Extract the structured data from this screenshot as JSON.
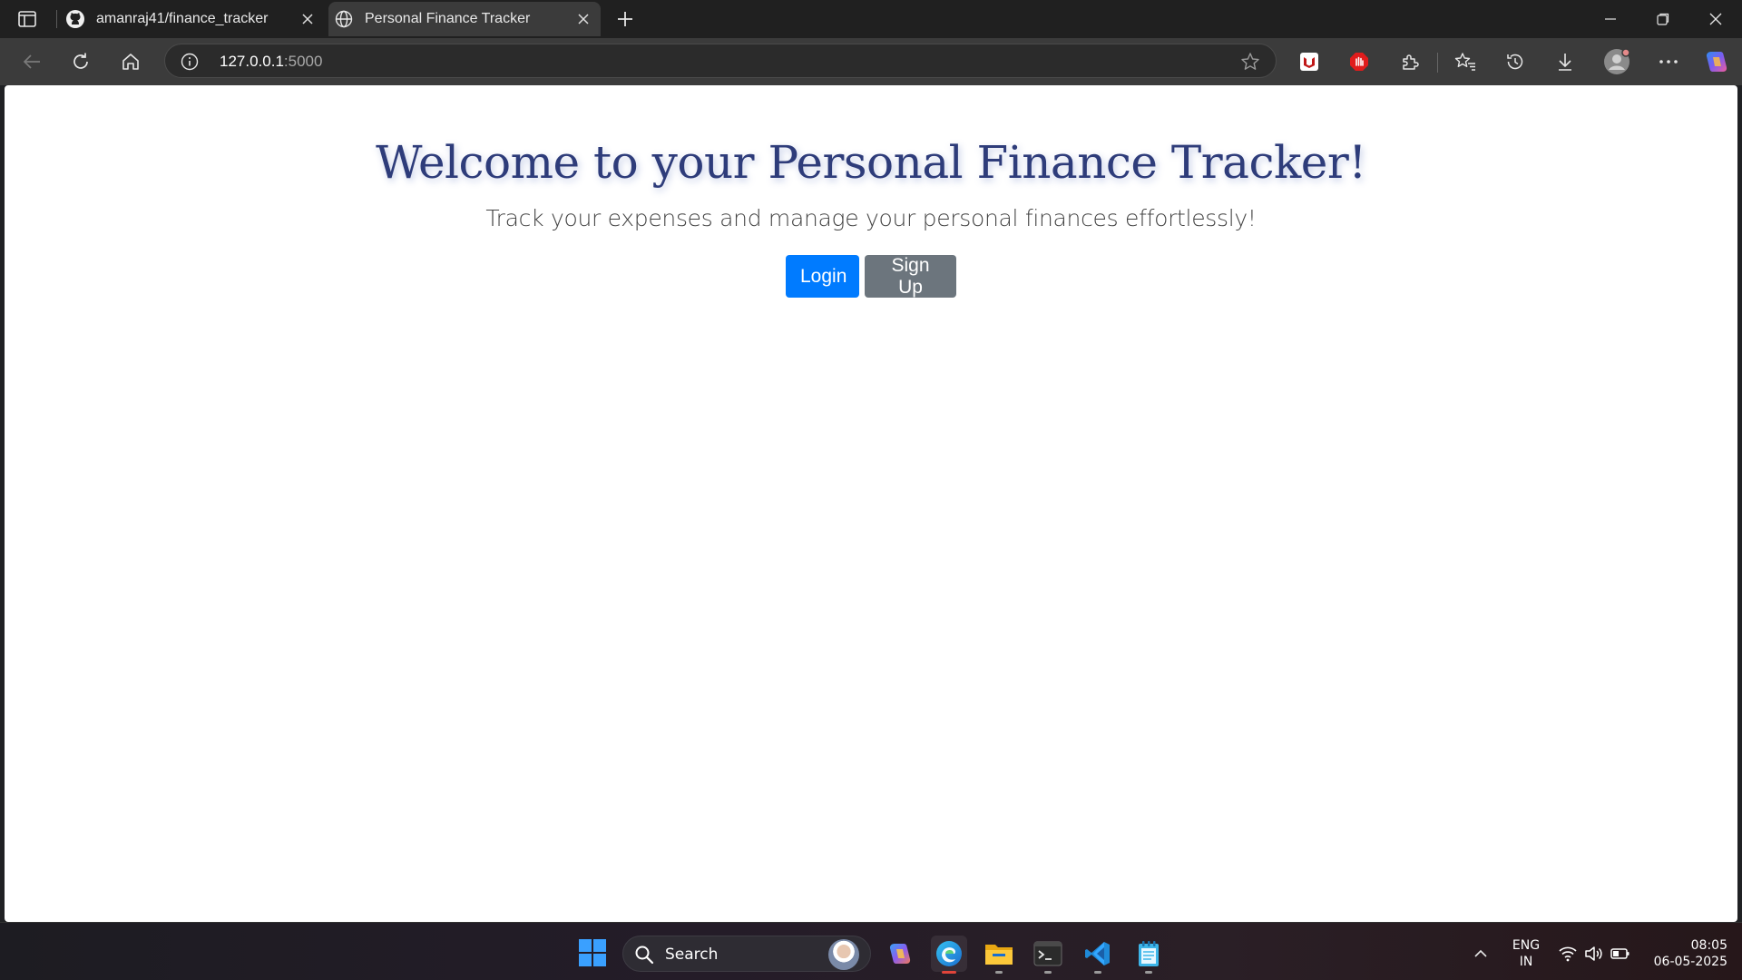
{
  "browser": {
    "tabs": [
      {
        "title": "amanraj41/finance_tracker",
        "icon": "github-icon",
        "active": false
      },
      {
        "title": "Personal Finance Tracker",
        "icon": "globe-icon",
        "active": true
      }
    ],
    "address": {
      "host": "127.0.0.1",
      "port": ":5000"
    }
  },
  "page": {
    "title": "Welcome to your Personal Finance Tracker!",
    "subtitle": "Track your expenses and manage your personal finances effortlessly!",
    "login_label": "Login",
    "signup_label": "Sign Up",
    "colors": {
      "title": "#2e3c7a",
      "primary": "#007bff",
      "secondary": "#6c757d"
    }
  },
  "taskbar": {
    "search_label": "Search",
    "lang_line1": "ENG",
    "lang_line2": "IN",
    "time": "08:05",
    "date": "06-05-2025"
  }
}
